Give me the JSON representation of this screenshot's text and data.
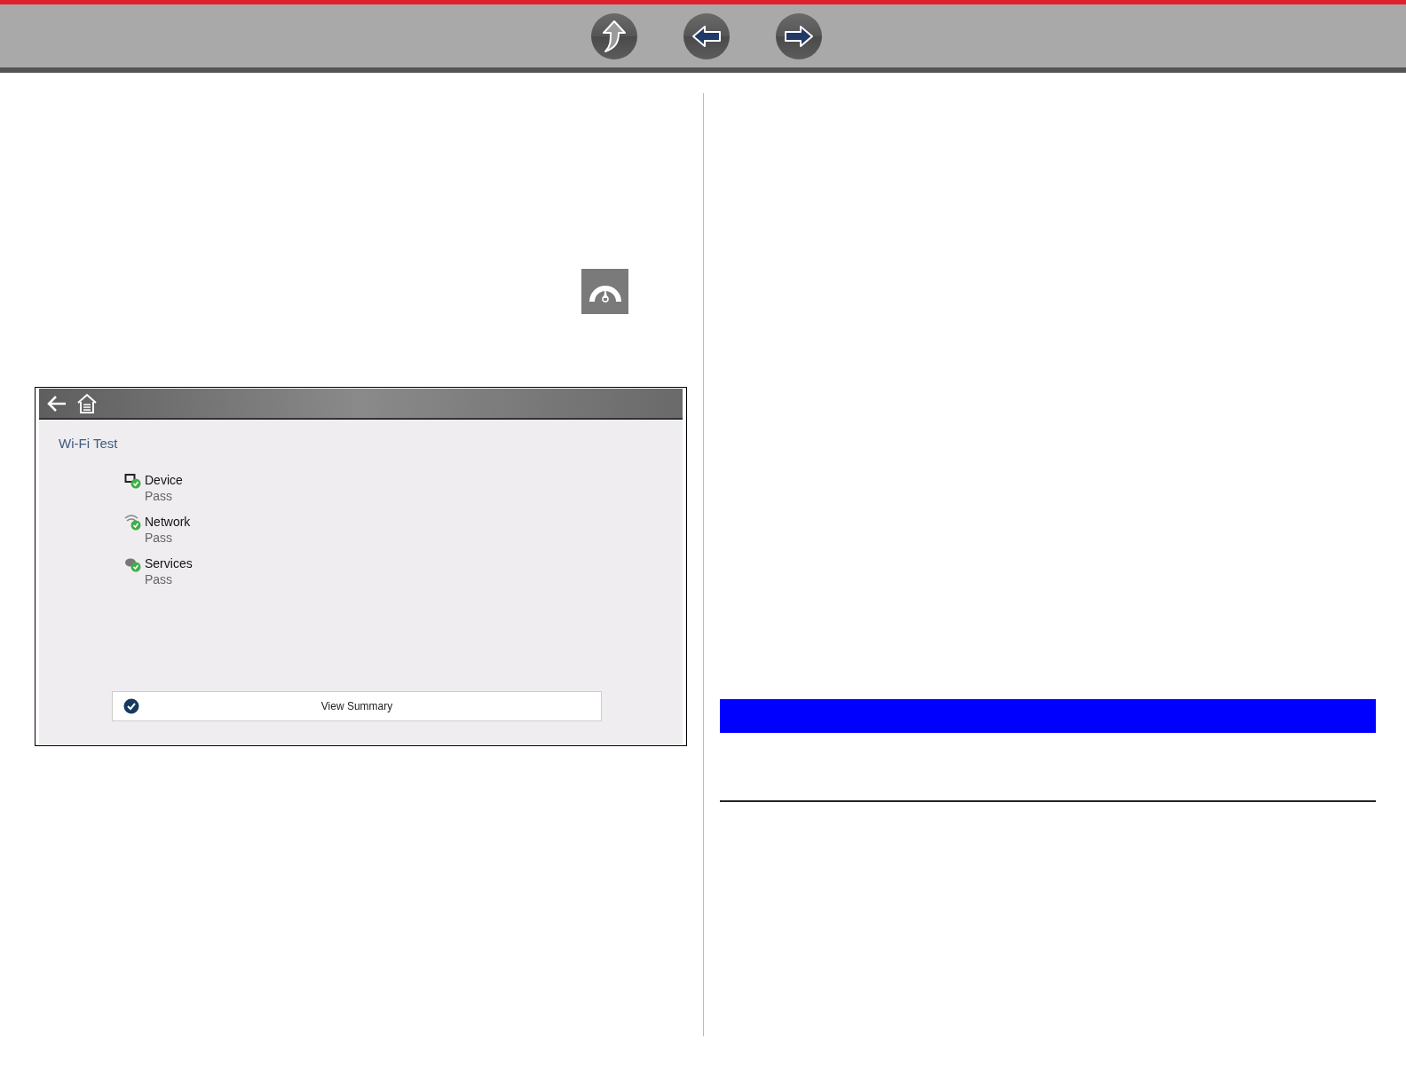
{
  "nav_buttons": [
    {
      "kind": "up"
    },
    {
      "kind": "back"
    },
    {
      "kind": "forward"
    }
  ],
  "wifi_screen": {
    "title": "Wi-Fi Test",
    "tests": [
      {
        "kind": "device",
        "name": "Device",
        "status": "Pass"
      },
      {
        "kind": "network",
        "name": "Network",
        "status": "Pass"
      },
      {
        "kind": "services",
        "name": "Services",
        "status": "Pass"
      }
    ],
    "summary_button": "View Summary"
  }
}
